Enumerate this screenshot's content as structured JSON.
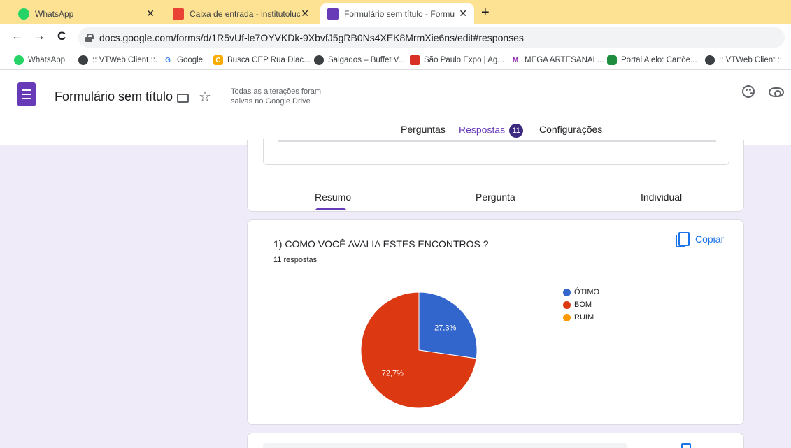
{
  "browser": {
    "tabs": [
      {
        "label": "WhatsApp",
        "icon": "whatsapp-icon",
        "color": "#25d366"
      },
      {
        "label": "Caixa de entrada - institutolucas",
        "icon": "gmail-icon",
        "color": "#ea4335"
      },
      {
        "label": "Formulário sem título - Formulár",
        "icon": "forms-icon",
        "color": "#673ab7"
      }
    ],
    "close_glyph": "✕",
    "new_tab_glyph": "+",
    "url": "docs.google.com/forms/d/1R5vUf-le7OYVKDk-9XbvfJ5gRB0Ns4XEK8MrmXie6ns/edit#responses",
    "nav": {
      "back": "←",
      "forward": "→",
      "reload": "C"
    },
    "bookmarks": [
      {
        "label": "WhatsApp",
        "icon": "whatsapp-icon",
        "color": "#25d366",
        "glyph": ""
      },
      {
        "label": ":: VTWeb Client ::.",
        "icon": "globe-icon",
        "color": "#3c4043",
        "glyph": ""
      },
      {
        "label": "Google",
        "icon": "google-icon",
        "color": "#ffffff",
        "glyph": "G"
      },
      {
        "label": "Busca CEP Rua Diac...",
        "icon": "cep-icon",
        "color": "#f9ab00",
        "glyph": "C"
      },
      {
        "label": "Salgados – Buffet V...",
        "icon": "globe-icon",
        "color": "#3c4043",
        "glyph": ""
      },
      {
        "label": "São Paulo Expo | Ag...",
        "icon": "expo-icon",
        "color": "#d93025",
        "glyph": ""
      },
      {
        "label": "MEGA ARTESANAL...",
        "icon": "mega-icon",
        "color": "#8e24aa",
        "glyph": "M"
      },
      {
        "label": "Portal Alelo: Cartõe...",
        "icon": "alelo-icon",
        "color": "#1e8e3e",
        "glyph": ""
      },
      {
        "label": ":: VTWeb Client ::.",
        "icon": "globe-icon",
        "color": "#3c4043",
        "glyph": ""
      }
    ]
  },
  "form": {
    "title": "Formulário sem título",
    "saved_status": "Todas as alterações foram salvas no Google Drive",
    "star_glyph": "☆",
    "tabs": {
      "questions": "Perguntas",
      "responses": "Respostas",
      "responses_count": "11",
      "settings": "Configurações"
    }
  },
  "summary_tabs": {
    "summary": "Resumo",
    "question": "Pergunta",
    "individual": "Individual"
  },
  "question": {
    "title": "1) COMO VOCÊ AVALIA ESTES ENCONTROS ?",
    "responses_label": "11 respostas",
    "copy_label": "Copiar"
  },
  "chart_data": {
    "type": "pie",
    "labels": [
      "ÓTIMO",
      "BOM",
      "RUIM"
    ],
    "values": [
      27.3,
      72.7,
      0
    ],
    "value_labels": [
      "27,3%",
      "72,7%",
      ""
    ],
    "colors": [
      "#3366cc",
      "#dc3912",
      "#ff9900"
    ],
    "legend_position": "right"
  }
}
